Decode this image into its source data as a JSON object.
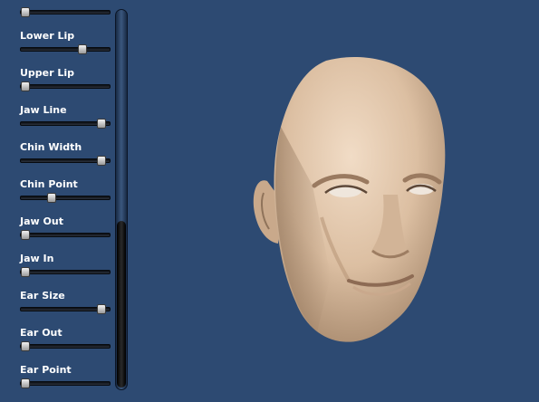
{
  "panel": {
    "sliders": [
      {
        "label": "",
        "value": 0.0
      },
      {
        "label": "Lower Lip",
        "value": 0.72
      },
      {
        "label": "Upper Lip",
        "value": 0.0
      },
      {
        "label": "Jaw Line",
        "value": 0.95
      },
      {
        "label": "Chin Width",
        "value": 0.95
      },
      {
        "label": "Chin Point",
        "value": 0.33
      },
      {
        "label": "Jaw Out",
        "value": 0.0
      },
      {
        "label": "Jaw In",
        "value": 0.0
      },
      {
        "label": "Ear Size",
        "value": 0.95
      },
      {
        "label": "Ear Out",
        "value": 0.0
      },
      {
        "label": "Ear Point",
        "value": 0.0
      }
    ],
    "scroll_position": 0.55,
    "scroll_visible_fraction": 0.44
  },
  "viewport": {
    "background_color": "#2d4a72",
    "skin_color": "#e8cbb0"
  }
}
